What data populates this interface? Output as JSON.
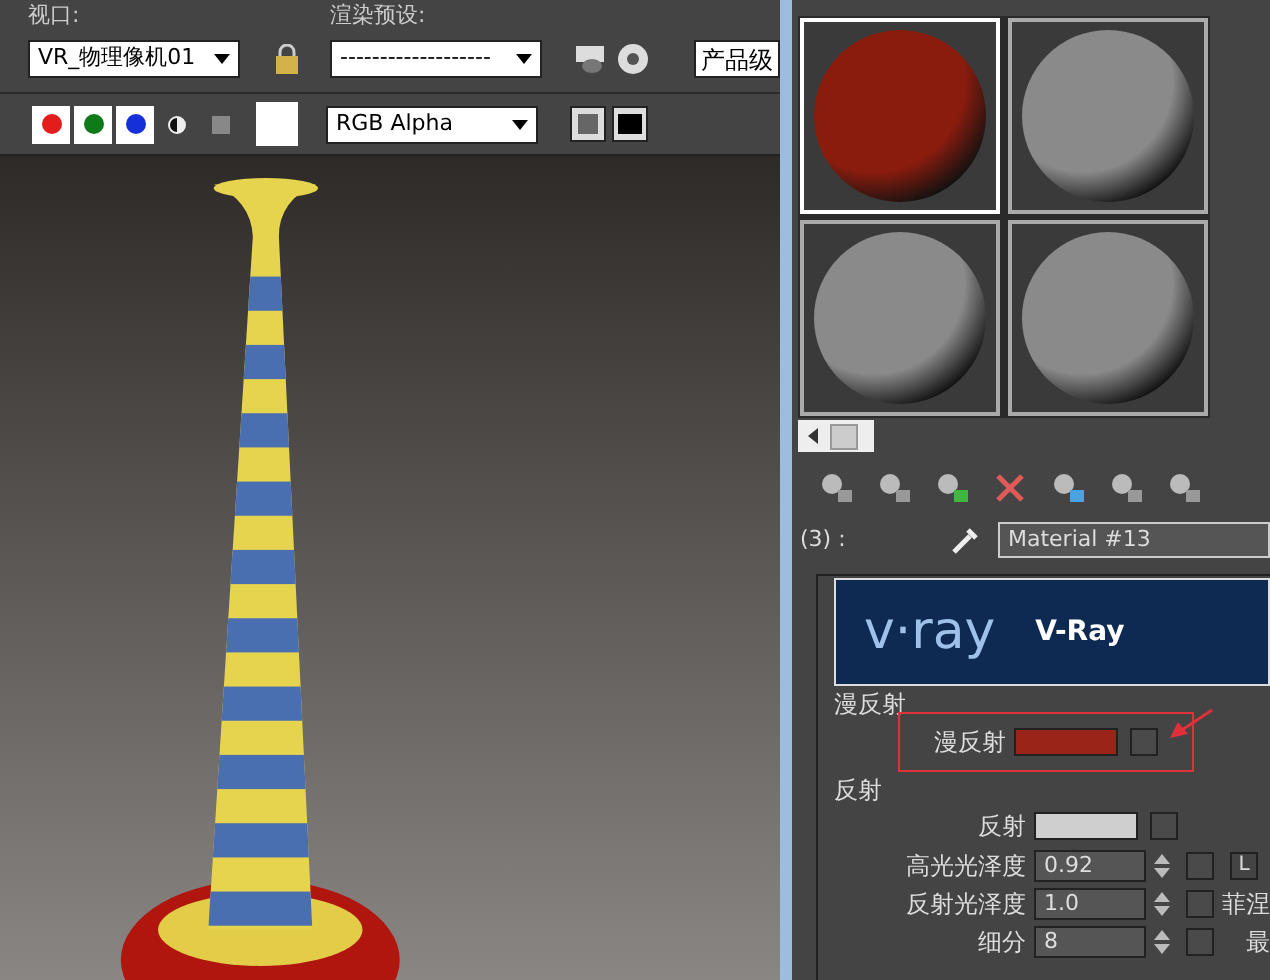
{
  "toolbar": {
    "viewport_label": "视口:",
    "viewport_value": "VR_物理像机01",
    "preset_label": "渲染预设:",
    "preset_value": "-------------------",
    "production_value": "产品级",
    "channels": [
      {
        "color": "#e31c1c"
      },
      {
        "color": "#0f7a18"
      },
      {
        "color": "#1530d8"
      }
    ],
    "display_value": "RGB Alpha"
  },
  "material_editor": {
    "slots": [
      {
        "selected": true,
        "color": "#8a1c0e"
      },
      {
        "selected": false,
        "color": "#8a8a8a"
      },
      {
        "selected": false,
        "color": "#8a8a8a"
      },
      {
        "selected": false,
        "color": "#8a8a8a"
      }
    ],
    "slot_label": "(3) :",
    "material_name": "Material #13",
    "banner": {
      "logo": "v·ray",
      "title": "V-Ray"
    },
    "diffuse_group": "漫反射",
    "diffuse": {
      "label": "漫反射",
      "color": "#9b2418"
    },
    "reflect_group": "反射",
    "reflect": {
      "label": "反射",
      "color": "#cfcfcf"
    },
    "params": [
      {
        "label": "高光光泽度",
        "value": "0.92",
        "extra": "L",
        "kind": "button"
      },
      {
        "label": "反射光泽度",
        "value": "1.0",
        "extra": "菲涅",
        "kind": "checkbox"
      },
      {
        "label": "细分",
        "value": "8",
        "extra": "最",
        "kind": "text"
      }
    ]
  }
}
